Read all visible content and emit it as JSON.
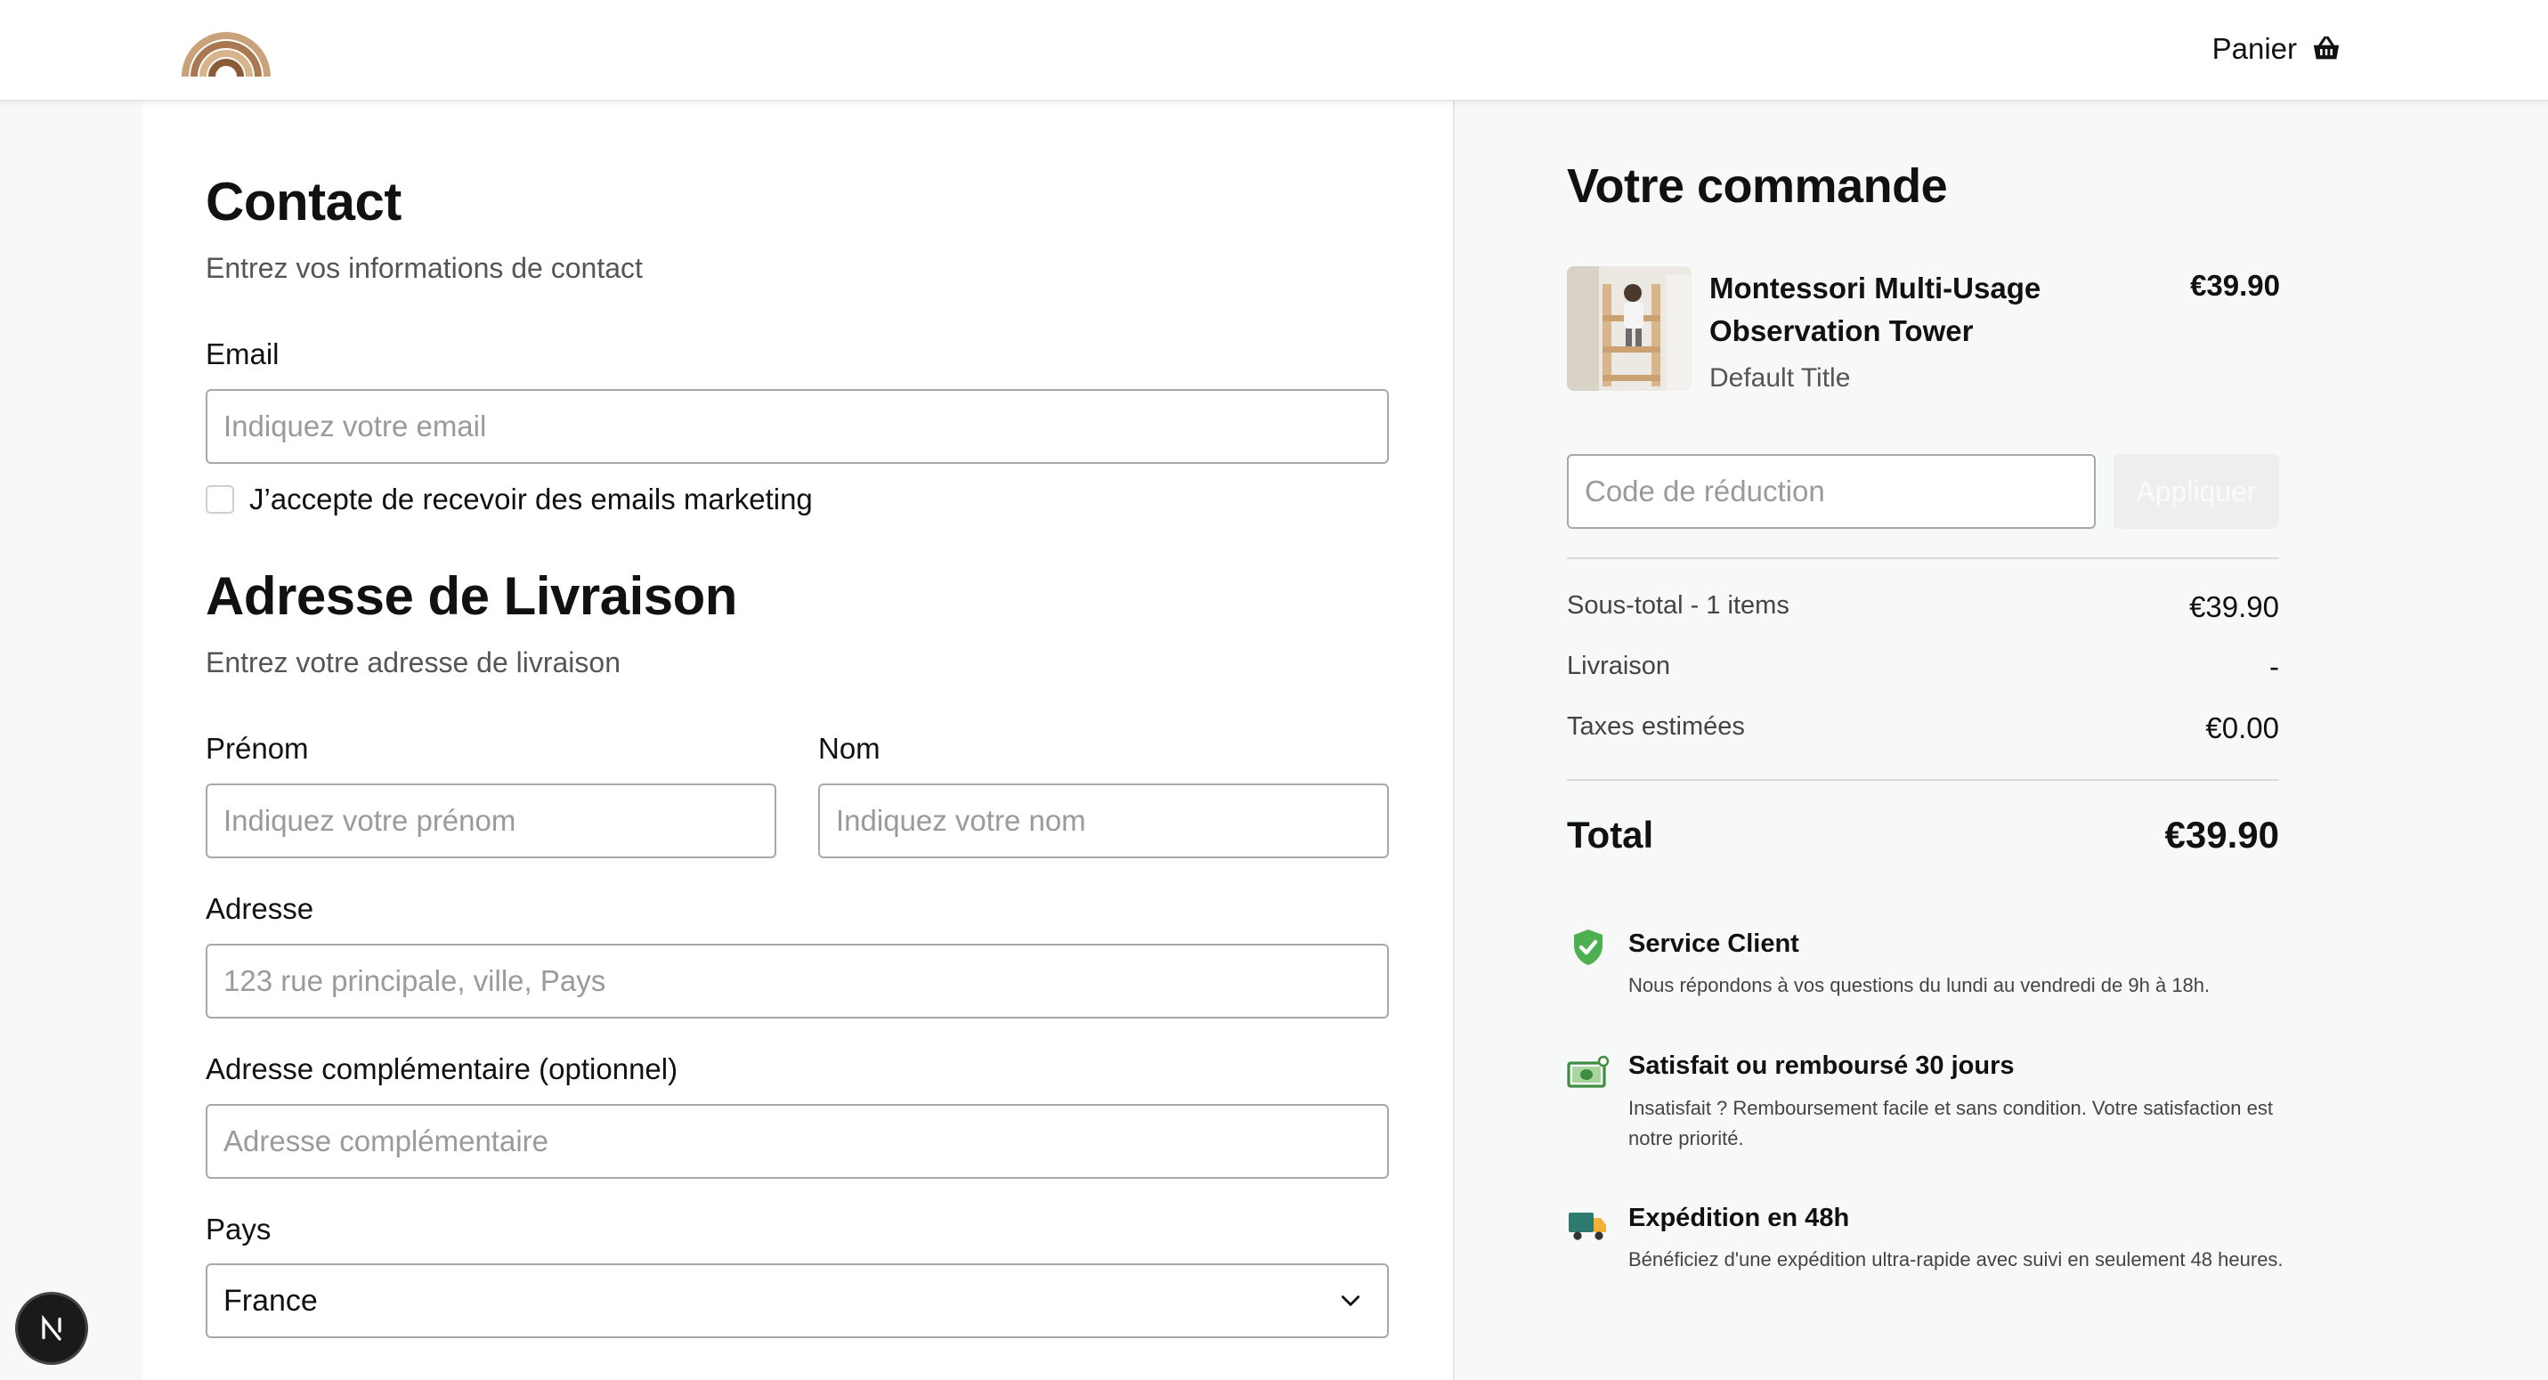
{
  "header": {
    "cart_label": "Panier",
    "logo_icon": "rainbow-logo",
    "cart_icon": "basket-icon"
  },
  "contact": {
    "title": "Contact",
    "subtitle": "Entrez vos informations de contact",
    "email_label": "Email",
    "email_placeholder": "Indiquez votre email",
    "email_value": "",
    "marketing_label": "J’accepte de recevoir des emails marketing",
    "marketing_checked": false
  },
  "shipping": {
    "title": "Adresse de Livraison",
    "subtitle": "Entrez votre adresse de livraison",
    "first_name_label": "Prénom",
    "first_name_placeholder": "Indiquez votre prénom",
    "last_name_label": "Nom",
    "last_name_placeholder": "Indiquez votre nom",
    "address_label": "Adresse",
    "address_placeholder": "123 rue principale, ville, Pays",
    "address2_label": "Adresse complémentaire (optionnel)",
    "address2_placeholder": "Adresse complémentaire",
    "country_label": "Pays",
    "country_value": "France"
  },
  "order": {
    "title": "Votre commande",
    "product": {
      "name": "Montessori Multi-Usage Observation Tower",
      "variant": "Default Title",
      "price": "€39.90"
    },
    "discount_placeholder": "Code de réduction",
    "apply_label": "Appliquer",
    "subtotal_label": "Sous-total - 1 items",
    "subtotal_value": "€39.90",
    "shipping_label": "Livraison",
    "shipping_value": "-",
    "tax_label": "Taxes estimées",
    "tax_value": "€0.00",
    "total_label": "Total",
    "total_value": "€39.90"
  },
  "features": [
    {
      "icon": "shield-check-icon",
      "title": "Service Client",
      "description": "Nous répondons à vos questions du lundi au vendredi de 9h à 18h."
    },
    {
      "icon": "money-icon",
      "title": "Satisfait ou remboursé 30 jours",
      "description": "Insatisfait ? Remboursement facile et sans condition. Votre satisfaction est notre priorité."
    },
    {
      "icon": "truck-icon",
      "title": "Expédition en 48h",
      "description": "Bénéficiez d'une expédition ultra-rapide avec suivi en seulement 48 heures."
    }
  ],
  "colors": {
    "shield": "#4caf50",
    "money": "#3e8e41",
    "truck": "#2f7a6e",
    "truck_wheels": "#f2b134"
  }
}
